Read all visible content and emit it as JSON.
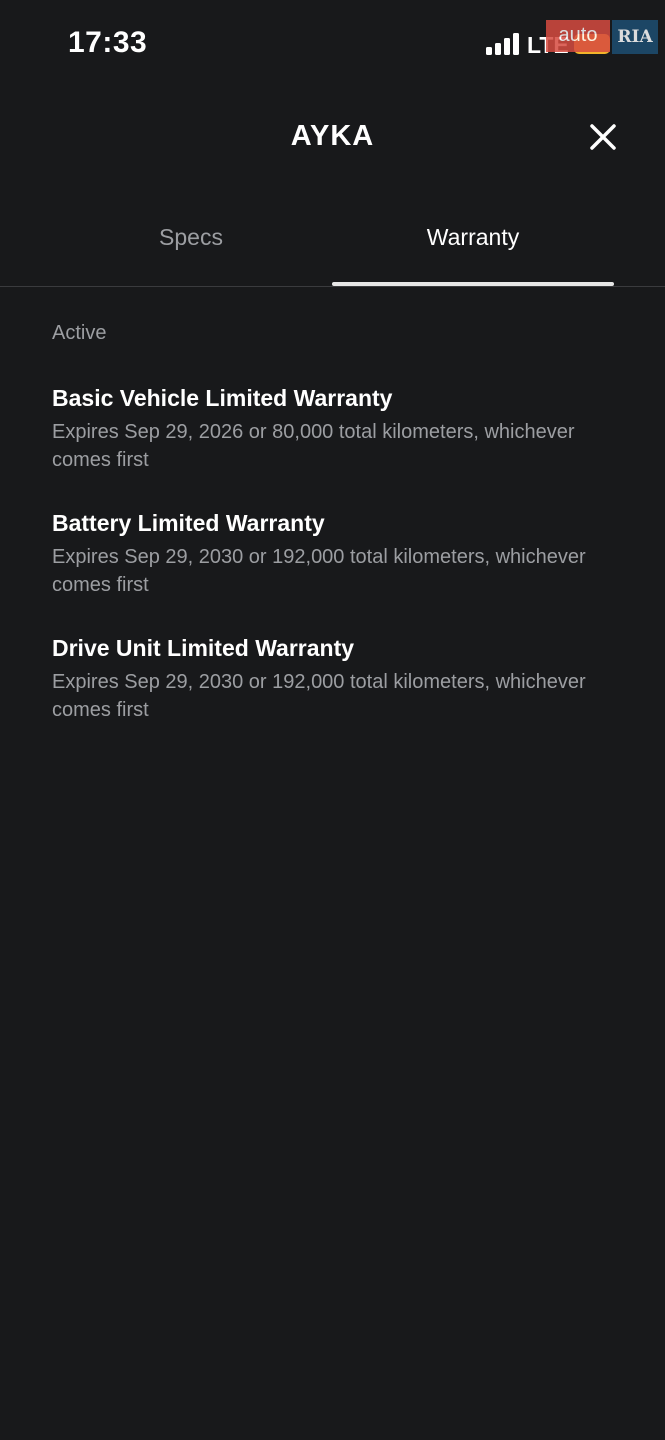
{
  "status_bar": {
    "time": "17:33",
    "network": "LTE",
    "signal_icon": "signal-bars-icon",
    "battery_icon": "battery-icon",
    "battery_color": "#f2b32b"
  },
  "watermark": {
    "brand_left": "auto",
    "brand_right": "RIA"
  },
  "header": {
    "title": "AYKA",
    "close_icon": "close-icon"
  },
  "tabs": [
    {
      "label": "Specs",
      "active": false
    },
    {
      "label": "Warranty",
      "active": true
    }
  ],
  "section": {
    "label": "Active"
  },
  "warranties": [
    {
      "name": "Basic Vehicle Limited Warranty",
      "description": "Expires Sep 29, 2026 or 80,000 total kilometers, whichever comes first"
    },
    {
      "name": "Battery Limited Warranty",
      "description": "Expires Sep 29, 2030 or 192,000 total kilometers, whichever comes first"
    },
    {
      "name": "Drive Unit Limited Warranty",
      "description": "Expires Sep 29, 2030 or 192,000 total kilometers, whichever comes first"
    }
  ],
  "colors": {
    "background": "#18191b",
    "primary_text": "#ffffff",
    "secondary_text": "#9c9ea2",
    "divider": "#3a3b3e"
  }
}
